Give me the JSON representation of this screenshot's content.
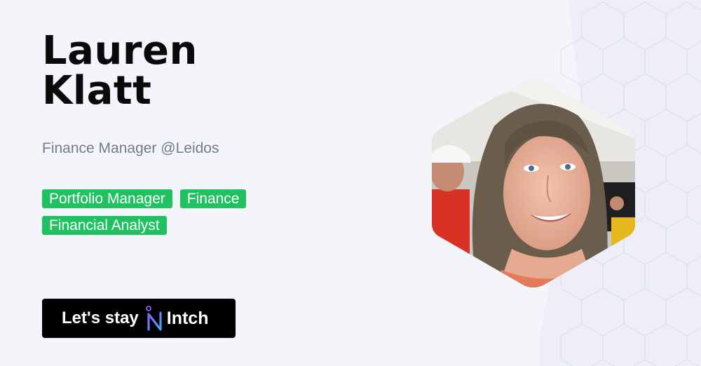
{
  "profile": {
    "first_name": "Lauren",
    "last_name": "Klatt",
    "headline": "Finance Manager @Leidos",
    "tags": [
      "Portfolio Manager",
      "Finance",
      "Financial Analyst"
    ],
    "photo_icon": "profile-photo"
  },
  "cta": {
    "label": "Let's stay",
    "brand": "Intch",
    "brand_icon": "intch-logo-icon"
  },
  "colors": {
    "background": "#f4f5fb",
    "tag_green": "#20c161",
    "cta_black": "#000000",
    "subtitle_gray": "#737b8c",
    "logo_gradient_start": "#8a5cf6",
    "logo_gradient_end": "#3ea7f5"
  }
}
